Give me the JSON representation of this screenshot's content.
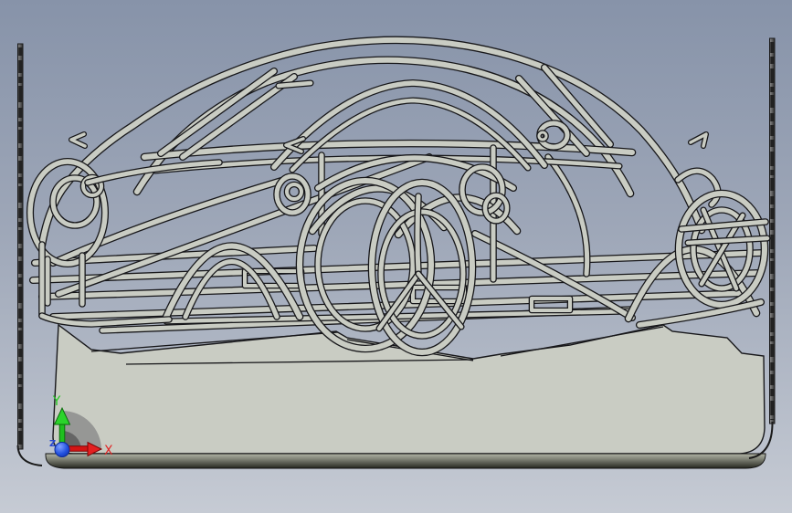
{
  "colors": {
    "background_top": "#8793a9",
    "background_bottom": "#c6cbd4",
    "sheet_fill": "#c9ccc3",
    "sheet_outline": "#17171a",
    "base_band_top": "#a8ab9c",
    "base_band_bottom": "#26271f",
    "post_fill": "#6e6e6e",
    "axis_x": "#e02020",
    "axis_y": "#22c822",
    "axis_z": "#2747d0",
    "origin_sphere": "#1b3fd4"
  },
  "axis_triad": {
    "x_label": "X",
    "y_label": "Y",
    "z_label": "Z"
  }
}
